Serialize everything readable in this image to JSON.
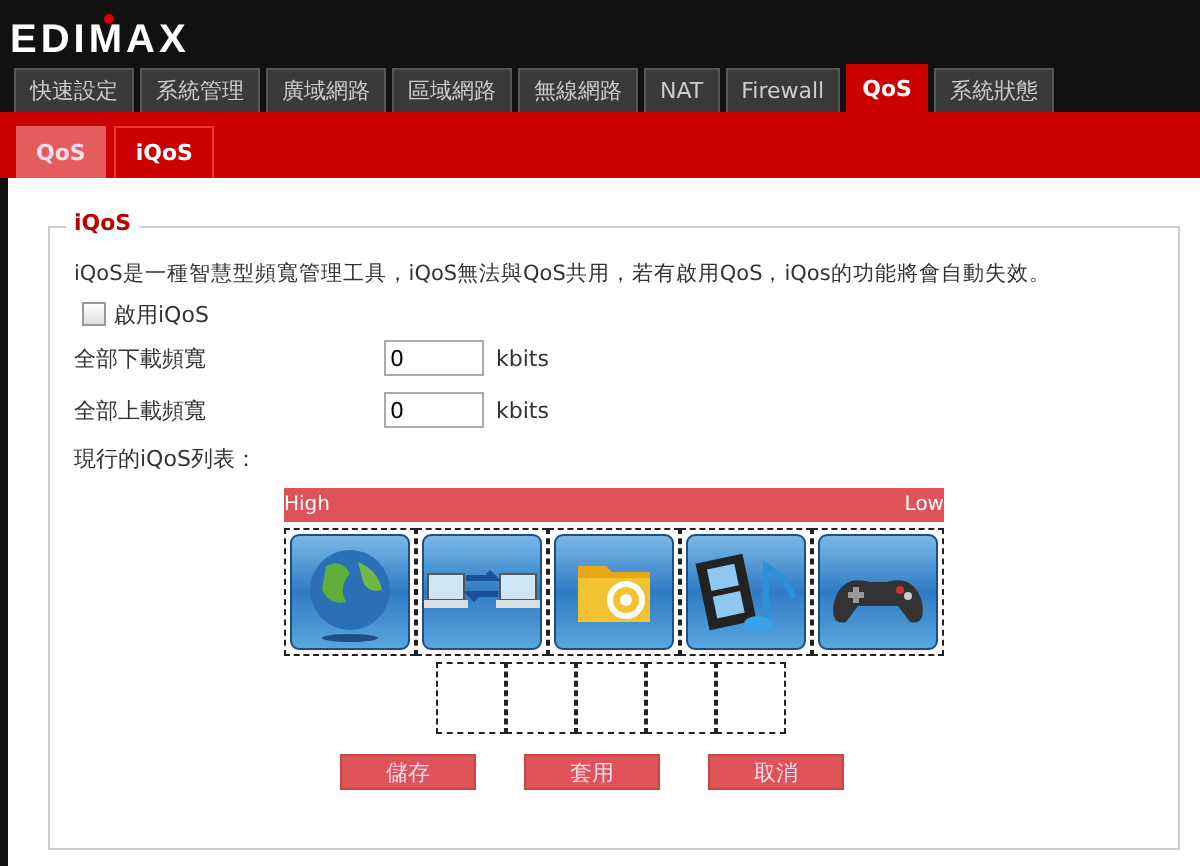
{
  "logo": "EDIMAX",
  "tabs": [
    {
      "label": "快速設定",
      "selected": false
    },
    {
      "label": "系統管理",
      "selected": false
    },
    {
      "label": "廣域網路",
      "selected": false
    },
    {
      "label": "區域網路",
      "selected": false
    },
    {
      "label": "無線網路",
      "selected": false
    },
    {
      "label": "NAT",
      "selected": false
    },
    {
      "label": "Firewall",
      "selected": false
    },
    {
      "label": "QoS",
      "selected": true
    },
    {
      "label": "系統狀態",
      "selected": false
    }
  ],
  "subtabs": [
    {
      "label": "QoS",
      "selected": false
    },
    {
      "label": "iQoS",
      "selected": true
    }
  ],
  "section": {
    "title": "iQoS",
    "description": "iQoS是一種智慧型頻寬管理工具，iQoS無法與QoS共用，若有啟用QoS，iQos的功能將會自動失效。",
    "enable": {
      "label": "啟用iQoS",
      "checked": false
    },
    "fields": [
      {
        "label": "全部下載頻寬",
        "value": "0",
        "unit": "kbits"
      },
      {
        "label": "全部上載頻寬",
        "value": "0",
        "unit": "kbits"
      }
    ],
    "list_label": "現行的iQoS列表：",
    "priority": {
      "high": "High",
      "low": "Low"
    },
    "apps": [
      {
        "kind": "globe"
      },
      {
        "kind": "network"
      },
      {
        "kind": "mail"
      },
      {
        "kind": "media"
      },
      {
        "kind": "game"
      }
    ],
    "buttons": [
      "儲存",
      "套用",
      "取消"
    ]
  }
}
